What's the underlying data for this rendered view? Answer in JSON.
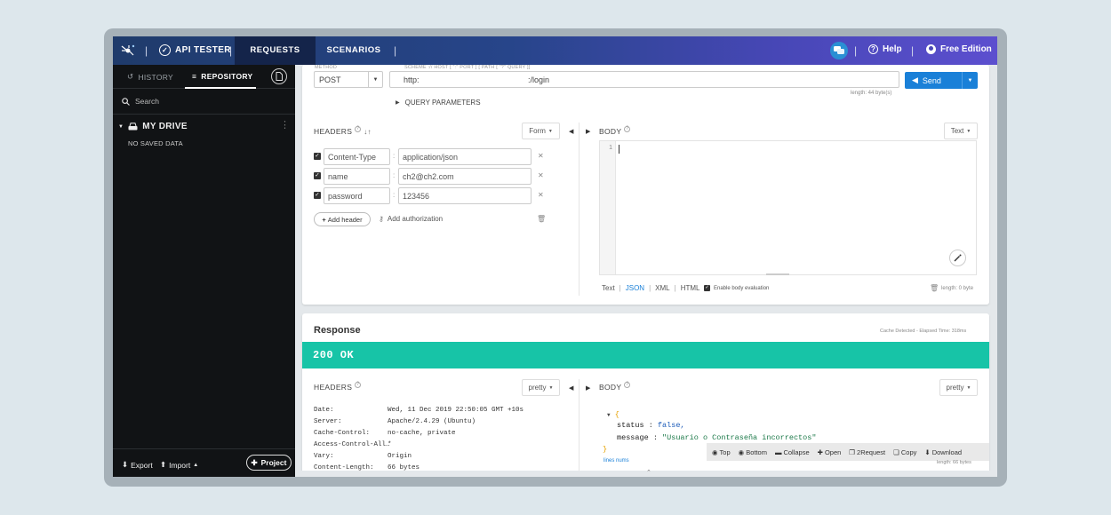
{
  "topbar": {
    "brand": "API TESTER",
    "tabs": [
      "REQUESTS",
      "SCENARIOS"
    ],
    "help": "Help",
    "edition": "Free Edition"
  },
  "sidebar": {
    "tabs": {
      "history": "HISTORY",
      "repository": "REPOSITORY"
    },
    "search_placeholder": "Search",
    "drive_label": "MY DRIVE",
    "empty_text": "NO SAVED DATA",
    "export_label": "Export",
    "import_label": "Import",
    "project_label": "Project"
  },
  "request": {
    "method_label": "METHOD",
    "url_hint": "SCHEME :// HOST [ \":\" PORT ] [ PATH [ \"?\" QUERY ]]",
    "method": "POST",
    "url_scheme": "http:",
    "url_path": ":/login",
    "url_length": "length: 44 byte(s)",
    "send_label": "Send",
    "query_params": "QUERY PARAMETERS",
    "headers_title": "HEADERS",
    "headers_mode": "Form",
    "headers": [
      {
        "key": "Content-Type",
        "value": "application/json"
      },
      {
        "key": "name",
        "value": "ch2@ch2.com"
      },
      {
        "key": "password",
        "value": "123456"
      }
    ],
    "add_header": "Add header",
    "add_authorization": "Add authorization",
    "body_title": "BODY",
    "body_mode": "Text",
    "body_line": "1",
    "formats": [
      "Text",
      "JSON",
      "XML",
      "HTML"
    ],
    "active_format": "JSON",
    "enable_eval": "Enable body evaluation",
    "body_length": "length: 0 byte"
  },
  "response": {
    "title": "Response",
    "cache_info": "Cache Detected - Elapsed Time: 318ms",
    "status": "200 OK",
    "headers_title": "HEADERS",
    "headers_mode": "pretty",
    "body_title": "BODY",
    "body_mode": "pretty",
    "headers": [
      {
        "key": "Date:",
        "value": "Wed, 11 Dec 2019 22:50:05 GMT +10s"
      },
      {
        "key": "Server:",
        "value": "Apache/2.4.29 (Ubuntu)"
      },
      {
        "key": "Cache-Control:",
        "value": "no-cache, private"
      },
      {
        "key": "Access-Control-All…",
        "value": "*"
      },
      {
        "key": "Vary:",
        "value": "Origin"
      },
      {
        "key": "Content-Length:",
        "value": "66 bytes"
      }
    ],
    "json": {
      "status_key": "status",
      "status_value": "false,",
      "message_key": "message",
      "message_value": "\"Usuario o Contraseña incorrectos\""
    },
    "lines_nums": "lines nums",
    "toolbar": [
      "Top",
      "Bottom",
      "Collapse",
      "Open",
      "2Request",
      "Copy",
      "Download"
    ],
    "length": "length: 66 bytes"
  }
}
